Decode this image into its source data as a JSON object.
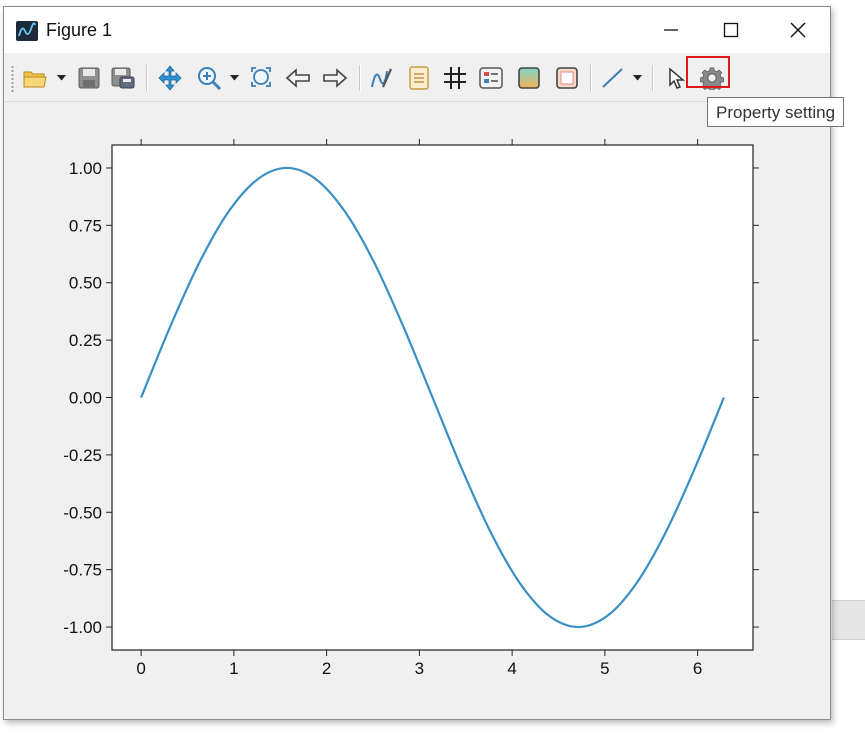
{
  "window": {
    "title": "Figure 1",
    "controls": [
      "minimize",
      "maximize",
      "close"
    ]
  },
  "toolbar": {
    "buttons": [
      {
        "name": "open-folder-icon",
        "dropdown": true
      },
      {
        "name": "save-icon"
      },
      {
        "name": "save-as-icon"
      },
      {
        "name": "pan-icon"
      },
      {
        "name": "zoom-in-icon",
        "dropdown": true
      },
      {
        "name": "zoom-fit-icon"
      },
      {
        "name": "back-arrow-icon"
      },
      {
        "name": "forward-arrow-icon"
      },
      {
        "name": "edit-curve-icon"
      },
      {
        "name": "legend-icon"
      },
      {
        "name": "grid-icon"
      },
      {
        "name": "data-table-icon"
      },
      {
        "name": "colormap-icon"
      },
      {
        "name": "frame-icon"
      },
      {
        "name": "line-style-icon",
        "dropdown": true
      },
      {
        "name": "select-pointer-icon"
      },
      {
        "name": "gear-icon",
        "highlighted": true
      }
    ],
    "tooltip": "Property setting",
    "highlight_color": "#e01818"
  },
  "chart_data": {
    "type": "line",
    "title": "",
    "xlabel": "",
    "ylabel": "",
    "xlim": [
      -0.314,
      6.597
    ],
    "ylim": [
      -1.1,
      1.1
    ],
    "xticks": [
      0,
      1,
      2,
      3,
      4,
      5,
      6
    ],
    "xtick_labels": [
      "0",
      "1",
      "2",
      "3",
      "4",
      "5",
      "6"
    ],
    "yticks": [
      1.0,
      0.75,
      0.5,
      0.25,
      0.0,
      -0.25,
      -0.5,
      -0.75,
      -1.0
    ],
    "ytick_labels": [
      "1.00",
      "0.75",
      "0.50",
      "0.25",
      "0.00",
      "-0.25",
      "-0.50",
      "-0.75",
      "-1.00"
    ],
    "grid": false,
    "series": [
      {
        "color": "#3a8fc4",
        "x": [
          0.0,
          0.314,
          0.628,
          0.942,
          1.257,
          1.571,
          1.885,
          2.199,
          2.513,
          2.827,
          3.142,
          3.456,
          3.77,
          4.084,
          4.398,
          4.712,
          5.027,
          5.341,
          5.655,
          5.969,
          6.283
        ],
        "y": [
          0.0,
          0.309,
          0.588,
          0.809,
          0.951,
          1.0,
          0.951,
          0.809,
          0.588,
          0.309,
          0.0,
          -0.309,
          -0.588,
          -0.809,
          -0.951,
          -1.0,
          -0.951,
          -0.809,
          -0.588,
          -0.309,
          0.0
        ]
      }
    ]
  }
}
